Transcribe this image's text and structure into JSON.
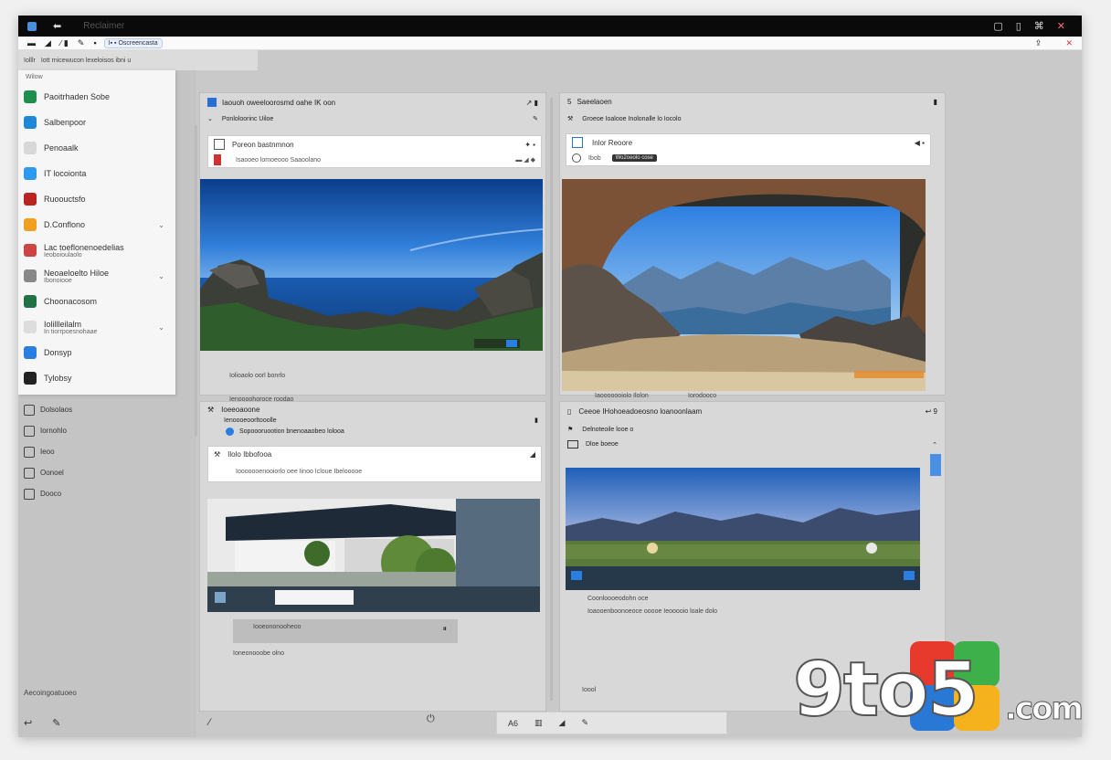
{
  "titlebar": {
    "back_icon": "arrow-back-icon",
    "title": "Reclaimer",
    "controls": [
      "▢",
      "▯",
      "⌘",
      "✕"
    ]
  },
  "toolbar": {
    "items": [
      "▬",
      "◢",
      "∕ ▮",
      "✎",
      "▪"
    ],
    "url": "I▪ ▪ Oscreencasta",
    "right_icons": [
      "⇪",
      "✕"
    ]
  },
  "subbar": {
    "label": "Iolllr",
    "text": "Iott rnicewucon lexeloisos ibni u"
  },
  "sidebar": {
    "header": "Wilow",
    "items": [
      {
        "label": "Paoitrhaden Sobe",
        "icon": "globe-icon",
        "color": "#1f8f4f"
      },
      {
        "label": "Salbenpoor",
        "icon": "browser-icon",
        "color": "#1f87d8"
      },
      {
        "label": "Penoaalk",
        "icon": "document-icon",
        "color": "#d8d8d8"
      },
      {
        "label": "IT locoionta",
        "icon": "cloud-icon",
        "color": "#2d9af0"
      },
      {
        "label": "Ruoouctsfo",
        "icon": "tools-icon",
        "color": "#b22"
      },
      {
        "label": "D.Conflono",
        "icon": "chat-icon",
        "color": "#f0a020"
      },
      {
        "label": "Lac toeflonenoedelias",
        "sub": "Ieoboioulaolo",
        "icon": "people-icon",
        "color": "#c44"
      },
      {
        "label": "Neoaeloelto Hiloe",
        "sub": "Ibonoiooe",
        "icon": "mail-icon",
        "color": "#888"
      },
      {
        "label": "Choonacosom",
        "icon": "sheet-icon",
        "color": "#217346"
      },
      {
        "label": "Iolillleilalm",
        "sub": "In tiorrpoesnohaae",
        "icon": "calendar-icon",
        "color": "#ddd"
      },
      {
        "label": "Donsyp",
        "icon": "store-icon",
        "color": "#2a7de1"
      },
      {
        "label": "Tylobsy",
        "icon": "circle-icon",
        "color": "#222"
      }
    ],
    "lower_items": [
      {
        "label": "Dolsolaos",
        "icon": "monitor-icon"
      },
      {
        "label": "Iornohlo",
        "icon": "list-icon"
      },
      {
        "label": "Ieoo",
        "icon": "link-icon"
      },
      {
        "label": "Oonoel",
        "icon": "power-icon"
      },
      {
        "label": "Dooco",
        "icon": "blank-icon"
      }
    ],
    "footer": "Aecoingoatuoeo"
  },
  "cards": [
    {
      "title": "Iaouoh oweeloorosmd oahe IK oon",
      "sub": "Ponloloorinc Uiloe",
      "inner_title": "Poreon bastnmnon",
      "inner_sub": "Isaooeo lomoeooo Saaoolano",
      "caption1": "Iolioaolo oorl bonrlo",
      "caption2": "Ienoooohoroce roodao"
    },
    {
      "title": "Saeelaoen",
      "sub": "Groeoe Ioalooe Inolonalle lo Iocolo",
      "inner_title": "Inlor Reoore",
      "inner_sub": "Ibob",
      "chip": "Wo2oeolo cose",
      "caption1": "Iaooooooiolo Ilolon",
      "caption2": "Iorodooco"
    },
    {
      "title": "Ioeeoaoone",
      "sub": "Ienoooeoorltooolle",
      "sub2": "Sopoooruootion bnenoaaobeo lolooa",
      "inner_title": "Ilolo Ibbofooa",
      "inner_sub": "Iooooooenooiorlo oee Iinoo Icloue Ibelooooe",
      "caption1": "Iooeononooheoo",
      "caption2": "Ioneonooobe olno"
    },
    {
      "title": "Ceeoe IHohoeadoeosno loanoonlaam",
      "sub": "Delnoteoile looe o",
      "inner_sub": "Dloe boeoe",
      "caption1": "Coonloooeodohn oce",
      "caption2": "Ioaooenboonoeoce ooooe Ieooooio loale dolo",
      "footer": "Ioool"
    }
  ],
  "bottombar": {
    "items": [
      "A6",
      "▥",
      "◢",
      "✎"
    ]
  },
  "watermark": {
    "text_prefix": "9to5",
    "text_suffix": ".com"
  }
}
